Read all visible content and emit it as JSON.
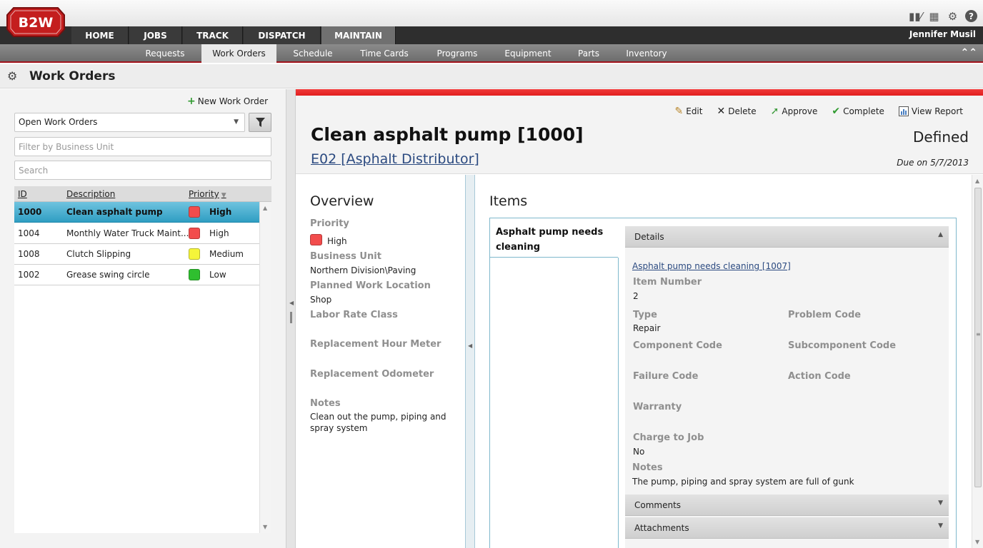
{
  "app": {
    "logo_text": "B2W",
    "brand_color": "#c41e1e",
    "user_name": "Jennifer Musil"
  },
  "top_icons": [
    "library-icon",
    "chart-icon",
    "gear-icon",
    "help-icon"
  ],
  "main_nav": {
    "tabs": [
      {
        "label": "HOME"
      },
      {
        "label": "JOBS"
      },
      {
        "label": "TRACK"
      },
      {
        "label": "DISPATCH"
      },
      {
        "label": "MAINTAIN",
        "active": true
      }
    ]
  },
  "sub_nav": {
    "items": [
      {
        "label": "Requests"
      },
      {
        "label": "Work Orders",
        "active": true
      },
      {
        "label": "Schedule"
      },
      {
        "label": "Time Cards"
      },
      {
        "label": "Programs"
      },
      {
        "label": "Equipment"
      },
      {
        "label": "Parts"
      },
      {
        "label": "Inventory"
      }
    ]
  },
  "page": {
    "title": "Work Orders"
  },
  "left": {
    "new_button": "New Work Order",
    "filter_select": "Open Work Orders",
    "business_unit_placeholder": "Filter by Business Unit",
    "search_placeholder": "Search",
    "columns": {
      "id": "ID",
      "description": "Description",
      "priority": "Priority"
    },
    "rows": [
      {
        "id": "1000",
        "description": "Clean asphalt pump",
        "priority": "High",
        "color": "#f24c4c",
        "selected": true
      },
      {
        "id": "1004",
        "description": "Monthly Water Truck Maint...",
        "priority": "High",
        "color": "#f24c4c"
      },
      {
        "id": "1008",
        "description": "Clutch Slipping",
        "priority": "Medium",
        "color": "#f5f53a"
      },
      {
        "id": "1002",
        "description": "Grease swing circle",
        "priority": "Low",
        "color": "#2fbf2f"
      }
    ]
  },
  "detail": {
    "actions": {
      "edit": "Edit",
      "delete": "Delete",
      "approve": "Approve",
      "complete": "Complete",
      "view_report": "View Report"
    },
    "title": "Clean asphalt pump [1000]",
    "status": "Defined",
    "equipment_link": "E02 [Asphalt Distributor]",
    "due": "Due on 5/7/2013"
  },
  "overview": {
    "title": "Overview",
    "priority_label": "Priority",
    "priority_value": "High",
    "business_unit_label": "Business Unit",
    "business_unit_value": "Northern Division\\Paving",
    "location_label": "Planned Work Location",
    "location_value": "Shop",
    "labor_label": "Labor Rate Class",
    "hour_meter_label": "Replacement Hour Meter",
    "odometer_label": "Replacement Odometer",
    "notes_label": "Notes",
    "notes_value": "Clean out the pump, piping and spray system"
  },
  "items": {
    "title": "Items",
    "tab_label": "Asphalt pump needs cleaning",
    "details_header": "Details",
    "item_link": "Asphalt pump needs cleaning [1007]",
    "item_number_label": "Item Number",
    "item_number_value": "2",
    "type_label": "Type",
    "type_value": "Repair",
    "problem_label": "Problem Code",
    "component_label": "Component Code",
    "subcomponent_label": "Subcomponent Code",
    "failure_label": "Failure Code",
    "action_label": "Action Code",
    "warranty_label": "Warranty",
    "charge_label": "Charge to Job",
    "charge_value": "No",
    "notes_label": "Notes",
    "notes_value": "The pump, piping and spray system are full of gunk",
    "comments_header": "Comments",
    "attachments_header": "Attachments"
  }
}
